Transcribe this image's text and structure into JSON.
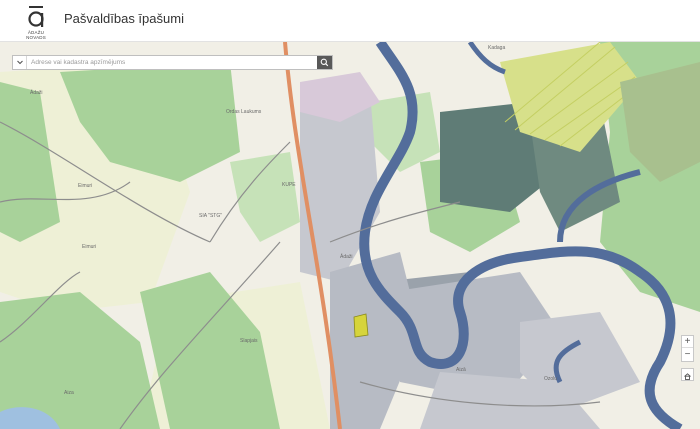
{
  "header": {
    "logo_text": "ĀDAŽU\nNOVADS",
    "title": "Pašvaldības īpašumi"
  },
  "search": {
    "placeholder": "Adrese vai kadastra apzīmējums",
    "dropdown_icon": "chevron-down-icon",
    "button_icon": "search-icon"
  },
  "map_controls": {
    "zoom_in": "+",
    "zoom_out": "−",
    "home_icon": "home-icon"
  },
  "place_labels": {
    "kadaga": "Kadaga",
    "adazi_north": "Ādaži",
    "ordas_laukums": "Ordas Laukums",
    "eimuri_1": "Eimuri",
    "eimuri_2": "Eimuri",
    "stgb": "SIA \"STG\"",
    "kurzemes": "KUPE ",
    "adazi_center": "Ādaži",
    "slapjais": "Slapjais",
    "aiza": "Aiza",
    "aiza_street": "Aizā",
    "ozolu": "Ozolu"
  },
  "colors": {
    "river": "#536d9b",
    "forest": "#a8d29a",
    "dark_forest": "#5f7c76",
    "residential": "#b7bbc4",
    "road_main": "#e08f63",
    "highlight": "#d6d43b"
  }
}
